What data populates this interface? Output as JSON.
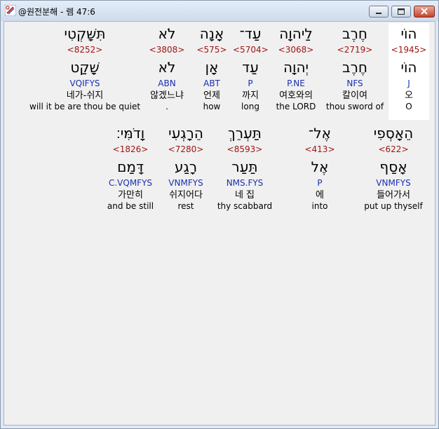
{
  "window": {
    "title": "@원전분해 - 렘 47:6",
    "icon": "app-logo-icon",
    "controls": [
      "minimize-icon",
      "maximize-icon",
      "close-icon"
    ]
  },
  "rows": [
    {
      "words": [
        {
          "heb": "הוֹי",
          "strong": "<1945>",
          "heb_lemma": "הוֹי",
          "parse": "J",
          "kor": "오",
          "eng": "O"
        },
        {
          "heb": "חֶרֶב",
          "strong": "<2719>",
          "heb_lemma": "חֶרֶב",
          "parse": "NFS",
          "kor": "칼이여",
          "eng": "thou sword of"
        },
        {
          "heb": "לַיהוָה",
          "strong": "<3068>",
          "heb_lemma": "יְהוָה",
          "parse": "P.NE",
          "kor": "여호와의",
          "eng": "the LORD"
        },
        {
          "heb": "עַד־",
          "strong": "<5704>",
          "heb_lemma": "עַד",
          "parse": "P",
          "kor": "까지",
          "eng": "long"
        },
        {
          "heb": "אָנָה",
          "strong": "<575>",
          "heb_lemma": "אָן",
          "parse": "ABT",
          "kor": "언제",
          "eng": "how"
        },
        {
          "heb": "לֹא",
          "strong": "<3808>",
          "heb_lemma": "לֹא",
          "parse": "ABN",
          "kor": "않겠느냐",
          "eng": "."
        },
        {
          "heb": "תִּשָּׁקְטִי",
          "strong": "<8252>",
          "heb_lemma": "שָׁקַט",
          "parse": "VQIFYS",
          "kor": "네가-쉬지",
          "eng": "will it be are thou be quiet"
        }
      ]
    },
    {
      "words": [
        {
          "heb": "הֵאָסְפִי",
          "strong": "<622>",
          "heb_lemma": "אָסַף",
          "parse": "VNMFYS",
          "kor": "들어가서",
          "eng": "put up thyself"
        },
        {
          "heb": "אֶל־",
          "strong": "<413>",
          "heb_lemma": "אֶל",
          "parse": "P",
          "kor": "에",
          "eng": "into"
        },
        {
          "heb": "תַּעְרֵךְ",
          "strong": "<8593>",
          "heb_lemma": "תַּעַר",
          "parse": "NMS.FYS",
          "kor": "네 집",
          "eng": "thy scabbard"
        },
        {
          "heb": "הֵרָגְעִי",
          "strong": "<7280>",
          "heb_lemma": "רָגַע",
          "parse": "VNMFYS",
          "kor": "쉬지어다",
          "eng": "rest"
        },
        {
          "heb": "וָדֹמִּי׃",
          "strong": "<1826>",
          "heb_lemma": "דָּמַם",
          "parse": "C.VQMFYS",
          "kor": "가만히",
          "eng": "and be still"
        }
      ]
    }
  ]
}
